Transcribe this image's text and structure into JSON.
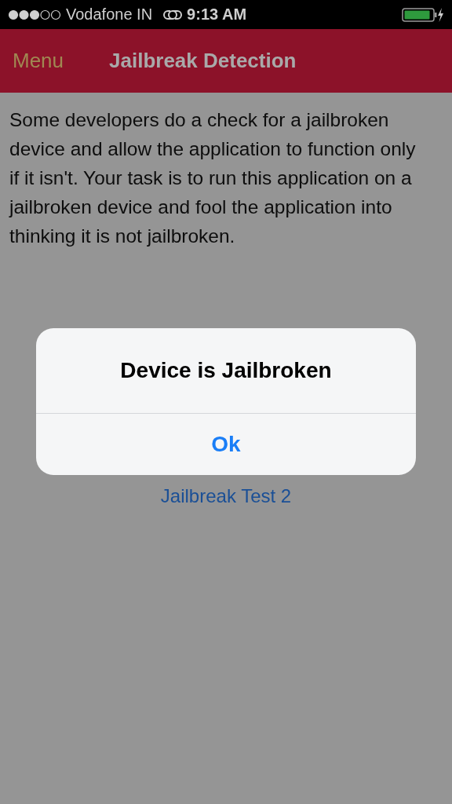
{
  "status_bar": {
    "carrier": "Vodafone IN",
    "time": "9:13 AM"
  },
  "nav_bar": {
    "menu": "Menu",
    "title": "Jailbreak Detection"
  },
  "description": "Some developers do a check for a jailbroken device and allow the application to function only if it isn't. Your task is to run this application on a jailbroken device and fool the application into thinking it is not jailbroken.",
  "buttons": [
    "Jailbreak Test 2"
  ],
  "alert": {
    "title": "Device is Jailbroken",
    "buttons": [
      "Ok"
    ]
  }
}
